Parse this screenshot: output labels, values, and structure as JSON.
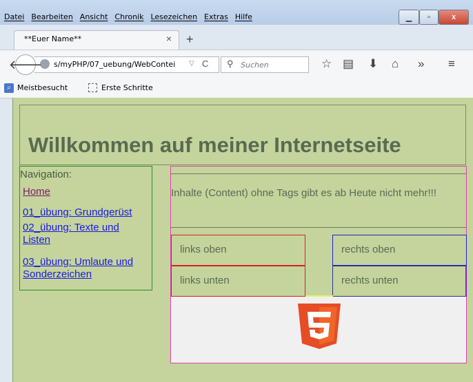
{
  "menu": {
    "items": [
      "Datei",
      "Bearbeiten",
      "Ansicht",
      "Chronik",
      "Lesezeichen",
      "Extras",
      "Hilfe"
    ]
  },
  "window_controls": {
    "close": "x"
  },
  "tab": {
    "title": "**Euer Name**",
    "close": "×",
    "new_tab": "+"
  },
  "navbar": {
    "url": "s/myPHP/07_uebung/WebContei",
    "search_placeholder": "Suchen"
  },
  "bookmarks": [
    {
      "label": "Meistbesucht",
      "icon": "bookmark-folder-icon"
    },
    {
      "label": "Erste Schritte",
      "icon": "page-icon"
    }
  ],
  "page": {
    "title": "Willkommen auf meiner Internetseite",
    "nav_label": "Navigation:",
    "nav_links": [
      "Home",
      "01_übung: Grundgerüst",
      "02_übung: Texte und Listen",
      "03_übung: Umlaute und Sonderzeichen"
    ],
    "main_text": "Inhalte (Content) ohne Tags gibt es ab Heute nicht mehr!!!",
    "cells": {
      "top_left": "links oben",
      "top_right": "rechts oben",
      "bottom_left": "links unten",
      "bottom_right": "rechts unten"
    },
    "logo": "html5-logo",
    "colors": {
      "background": "#c4d49c",
      "title": "#5a6a52",
      "link": "#1a1ae0",
      "visited_link": "#7a1a6a",
      "html5_orange": "#e44d26"
    }
  }
}
